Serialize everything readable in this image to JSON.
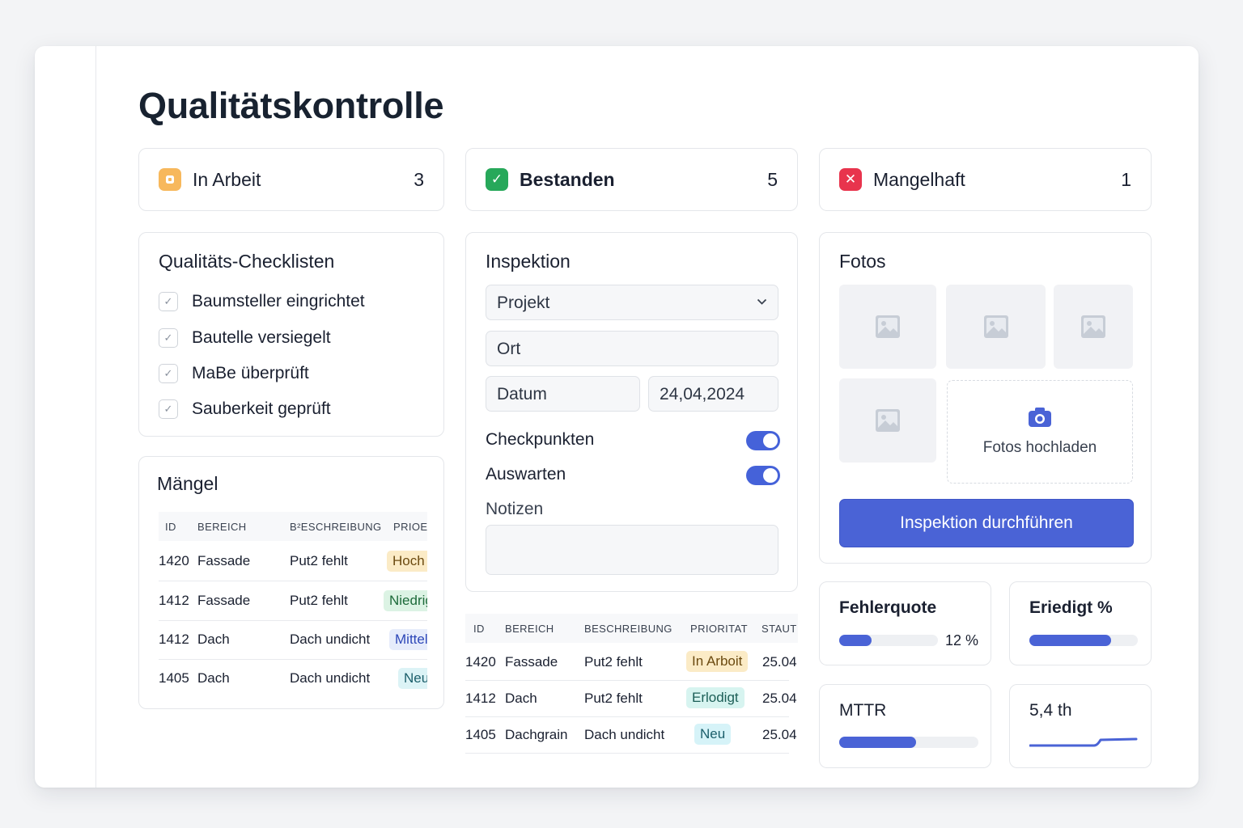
{
  "page": {
    "title": "Qualitätskontrolle"
  },
  "stats": [
    {
      "label": "In Arbeit",
      "count": "3",
      "icon": "status-in-progress-icon",
      "color": "#f7b85c",
      "glyph": "▢"
    },
    {
      "label": "Bestanden",
      "count": "5",
      "icon": "check-icon",
      "color": "#27a85a",
      "glyph": "✓"
    },
    {
      "label": "Mangelhaft",
      "count": "1",
      "icon": "x-icon",
      "color": "#e8344d",
      "glyph": "✕"
    }
  ],
  "checklist": {
    "title": "Qualitäts-Checklisten",
    "items": [
      {
        "label": "Baumsteller eingrichtet",
        "checked": true
      },
      {
        "label": "Bautelle versiegelt",
        "checked": true
      },
      {
        "label": "MaBe überprüft",
        "checked": true
      },
      {
        "label": "Sauberkeit geprüft",
        "checked": true
      }
    ]
  },
  "maengel": {
    "title": "Mängel",
    "headers": [
      "ID",
      "BEREICH",
      "B²ESCHREIBUNG",
      "PRIOE"
    ],
    "rows": [
      {
        "id": "1420",
        "area": "Fassade",
        "desc": "Put2 fehlt",
        "prio": "Hoch",
        "bg": "#fbebc6",
        "fg": "#6b4a10"
      },
      {
        "id": "1412",
        "area": "Fassade",
        "desc": "Put2 fehlt",
        "prio": "Niedrig",
        "bg": "#dcf3e4",
        "fg": "#1d6a3a"
      },
      {
        "id": "1412",
        "area": "Dach",
        "desc": "Dach undicht",
        "prio": "Mittel",
        "bg": "#e6ecfb",
        "fg": "#2d47b8"
      },
      {
        "id": "1405",
        "area": "Dach",
        "desc": "Dach undicht",
        "prio": "Neu",
        "bg": "#dcf3f6",
        "fg": "#1b5e6a"
      }
    ]
  },
  "inspektion": {
    "title": "Inspektion",
    "projekt_placeholder": "Projekt",
    "ort_placeholder": "Ort",
    "datum_label": "Datum",
    "datum_value": "24,04,2024",
    "toggles": [
      {
        "label": "Checkpunkten",
        "on": true
      },
      {
        "label": "Auswarten",
        "on": true
      }
    ],
    "notes_label": "Notizen"
  },
  "status_table": {
    "headers": [
      "ID",
      "BEREICH",
      "BESCHREIBUNG",
      "PRIORITAT",
      "STAUT"
    ],
    "rows": [
      {
        "id": "1420",
        "area": "Fassade",
        "desc": "Put2 fehlt",
        "status": "In Arboit",
        "date": "25.04",
        "bg": "#fbebc6",
        "fg": "#6b4a10"
      },
      {
        "id": "1412",
        "area": "Dach",
        "desc": "Put2 fehlt",
        "status": "Erlodigt",
        "date": "25.04",
        "bg": "#d7f4f0",
        "fg": "#1b5e56"
      },
      {
        "id": "1405",
        "area": "Dachgrain",
        "desc": "Dach undicht",
        "status": "Neu",
        "date": "25.04",
        "bg": "#d6f3f8",
        "fg": "#1b5e6a"
      }
    ]
  },
  "fotos": {
    "title": "Fotos",
    "upload_label": "Fotos hochladen",
    "button_label": "Inspektion durchführen"
  },
  "kpis": {
    "fehlerquote": {
      "title": "Fehlerquote",
      "value": "12 %",
      "fill": 0.33
    },
    "erledigt": {
      "title": "Eriedigt %",
      "fill": 0.75
    },
    "mttr": {
      "title": "MTTR",
      "fill": 0.55
    },
    "trend": {
      "title": "5,4 th"
    }
  },
  "colors": {
    "accent": "#4a63d6",
    "border": "#e4e6ea"
  }
}
